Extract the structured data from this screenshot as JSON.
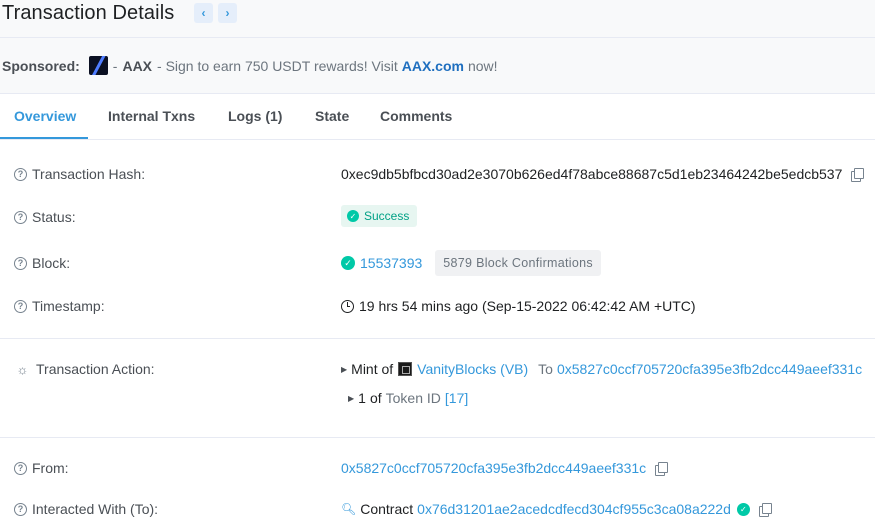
{
  "header": {
    "title": "Transaction Details",
    "prev_icon": "chevron-left-icon",
    "next_icon": "chevron-right-icon",
    "prev_glyph": "‹",
    "next_glyph": "›"
  },
  "sponsor": {
    "label": "Sponsored:",
    "brand": "AAX",
    "text_before": "- Sign to earn 750 USDT rewards! Visit",
    "link_text": "AAX.com",
    "text_after": "now!",
    "dash": "-"
  },
  "tabs": [
    {
      "label": "Overview",
      "active": true
    },
    {
      "label": "Internal Txns",
      "active": false
    },
    {
      "label": "Logs (1)",
      "active": false
    },
    {
      "label": "State",
      "active": false
    },
    {
      "label": "Comments",
      "active": false
    }
  ],
  "details": {
    "hash": {
      "label": "Transaction Hash:",
      "value": "0xec9db5bfbcd30ad2e3070b626ed4f78abce88687c5d1eb23464242be5edcb537"
    },
    "status": {
      "label": "Status:",
      "value": "Success"
    },
    "block": {
      "label": "Block:",
      "number": "15537393",
      "confirmations": "5879 Block Confirmations"
    },
    "timestamp": {
      "label": "Timestamp:",
      "value": "19 hrs 54 mins ago (Sep-15-2022 06:42:42 AM +UTC)"
    },
    "action": {
      "label": "Transaction Action:",
      "line1_prefix": "Mint of",
      "token_name": "VanityBlocks (VB)",
      "to_label": "To",
      "to_address": "0x5827c0ccf705720cfa395e3fb2dcc449aeef331c",
      "line2_count": "1",
      "line2_of": "of",
      "line2_token_label": "Token ID",
      "line2_token_id": "[17]"
    },
    "from": {
      "label": "From:",
      "value": "0x5827c0ccf705720cfa395e3fb2dcc449aeef331c"
    },
    "to": {
      "label": "Interacted With (To):",
      "contract_label": "Contract",
      "value": "0x76d31201ae2acedcdfecd304cf955c3ca08a222d"
    }
  },
  "colors": {
    "accent": "#3498db",
    "success": "#00c9a7",
    "text": "#1e2022",
    "muted": "#6c757e"
  }
}
